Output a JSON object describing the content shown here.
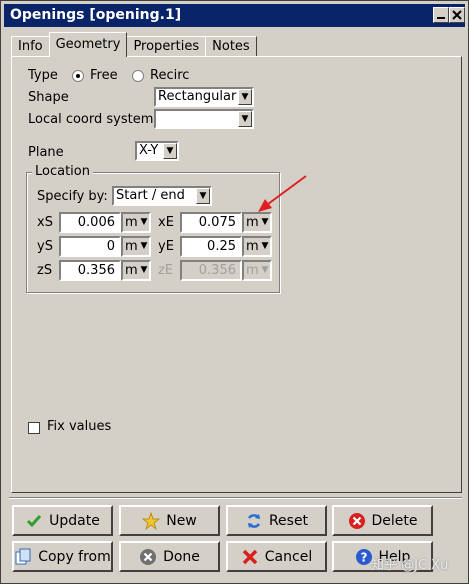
{
  "window": {
    "title": "Openings [opening.1]"
  },
  "tabs": [
    {
      "label": "Info"
    },
    {
      "label": "Geometry"
    },
    {
      "label": "Properties"
    },
    {
      "label": "Notes"
    }
  ],
  "geometry": {
    "type_label": "Type",
    "type_options": [
      "Free",
      "Recirc"
    ],
    "shape_label": "Shape",
    "shape_value": "Rectangular",
    "local_coord_label": "Local coord system",
    "local_coord_value": "",
    "plane_label": "Plane",
    "plane_value": "X-Y",
    "location": {
      "title": "Location",
      "specify_label": "Specify by:",
      "specify_value": "Start / end",
      "xs_label": "xS",
      "xs_value": "0.006",
      "xs_unit": "m",
      "ys_label": "yS",
      "ys_value": "0",
      "ys_unit": "m",
      "zs_label": "zS",
      "zs_value": "0.356",
      "zs_unit": "m",
      "xe_label": "xE",
      "xe_value": "0.075",
      "xe_unit": "m",
      "ye_label": "yE",
      "ye_value": "0.25",
      "ye_unit": "m",
      "ze_label": "zE",
      "ze_value": "0.356",
      "ze_unit": "m"
    },
    "fix_values_label": "Fix values"
  },
  "buttons": {
    "update": "Update",
    "new": "New",
    "reset": "Reset",
    "delete": "Delete",
    "copy_from": "Copy from",
    "done": "Done",
    "cancel": "Cancel",
    "help": "Help"
  },
  "watermark": "知乎 @JC.Xu",
  "colors": {
    "titlebar": "#0a246a",
    "face": "#d4d0c8",
    "annotation_arrow": "#e02020"
  }
}
